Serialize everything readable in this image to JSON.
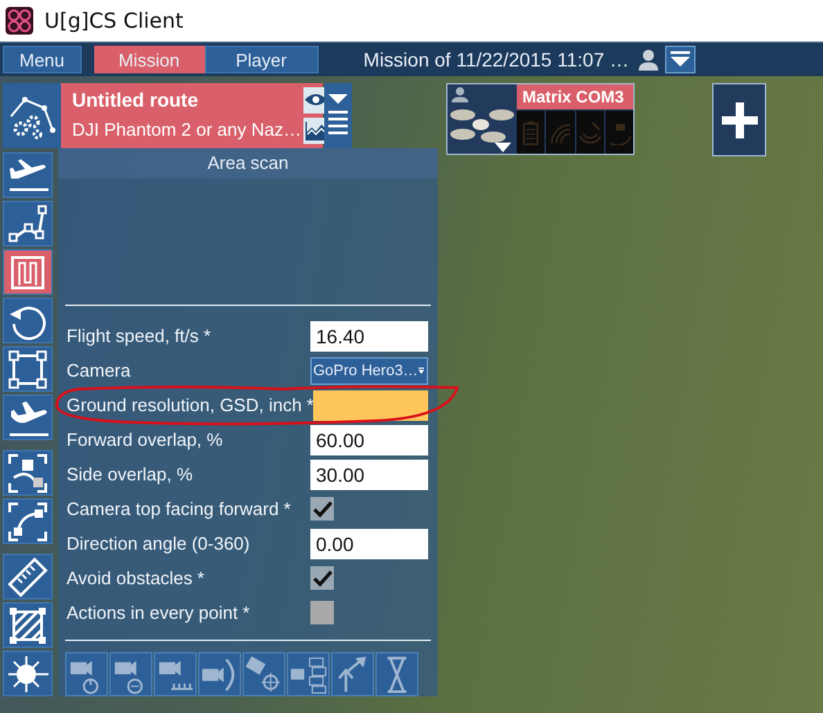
{
  "window": {
    "title": "U[g]CS Client"
  },
  "menu_tabs": [
    {
      "label": "Menu",
      "selected": false
    },
    {
      "label": "Mission",
      "selected": true
    },
    {
      "label": "Player",
      "selected": false
    }
  ],
  "mission_title": "Mission of 11/22/2015 11:07 …",
  "route": {
    "title": "Untitled route",
    "vehicle": "DJI Phantom 2 or any Naz…"
  },
  "vehicle_card": {
    "name": "Matrix COM3"
  },
  "tool_groups": [
    [
      {
        "selected": false
      },
      {
        "selected": false
      },
      {
        "selected": true
      },
      {
        "selected": false
      },
      {
        "selected": false
      },
      {
        "selected": false
      }
    ],
    [
      {
        "selected": false
      },
      {
        "selected": false
      }
    ],
    [
      {
        "selected": false
      },
      {
        "selected": false
      },
      {
        "selected": false
      }
    ]
  ],
  "panel": {
    "title": "Area scan",
    "params": [
      {
        "kind": "number",
        "label": "Flight speed, ft/s *",
        "value": "16.40",
        "invalid": false,
        "circled": false
      },
      {
        "kind": "dropdown",
        "label": "Camera",
        "value": "GoPro Hero3…",
        "circled": false
      },
      {
        "kind": "number",
        "label": "Ground resolution, GSD, inch *",
        "invalid": true,
        "circled": true
      },
      {
        "kind": "number",
        "label": "Forward overlap, %",
        "value": "60.00",
        "invalid": false,
        "circled": false
      },
      {
        "kind": "number",
        "label": "Side overlap, %",
        "value": "30.00",
        "invalid": false,
        "circled": false
      },
      {
        "kind": "checkbox",
        "label": "Camera top facing forward *",
        "checked": true,
        "disabled": false,
        "circled": false
      },
      {
        "kind": "number",
        "label": "Direction angle (0-360)",
        "value": "0.00",
        "invalid": false,
        "circled": false
      },
      {
        "kind": "checkbox",
        "label": "Avoid obstacles *",
        "checked": true,
        "disabled": false,
        "circled": false
      },
      {
        "kind": "checkbox",
        "label": "Actions in every point *",
        "checked": false,
        "disabled": true,
        "circled": false
      }
    ]
  }
}
